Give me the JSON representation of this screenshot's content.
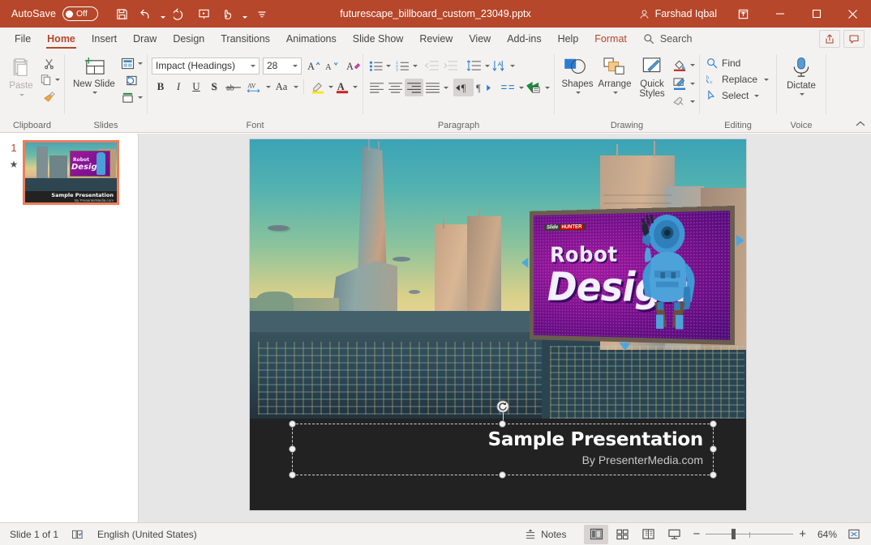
{
  "titlebar": {
    "autosave_label": "AutoSave",
    "autosave_state": "Off",
    "document_title": "futurescape_billboard_custom_23049.pptx",
    "account_name": "Farshad Iqbal",
    "qat": [
      {
        "name": "save-icon",
        "tooltip": "Save"
      },
      {
        "name": "undo-icon",
        "tooltip": "Undo"
      },
      {
        "name": "redo-icon",
        "tooltip": "Redo"
      },
      {
        "name": "start-slideshow-icon",
        "tooltip": "Start From Beginning"
      },
      {
        "name": "touch-mouse-mode-icon",
        "tooltip": "Touch/Mouse Mode"
      },
      {
        "name": "customize-qat-icon",
        "tooltip": "Customize Quick Access Toolbar"
      }
    ],
    "window_controls": [
      "ribbon-display-options",
      "minimize",
      "restore",
      "close"
    ]
  },
  "tabs": [
    {
      "label": "File",
      "active": false
    },
    {
      "label": "Home",
      "active": true
    },
    {
      "label": "Insert",
      "active": false
    },
    {
      "label": "Draw",
      "active": false
    },
    {
      "label": "Design",
      "active": false
    },
    {
      "label": "Transitions",
      "active": false
    },
    {
      "label": "Animations",
      "active": false
    },
    {
      "label": "Slide Show",
      "active": false
    },
    {
      "label": "Review",
      "active": false
    },
    {
      "label": "View",
      "active": false
    },
    {
      "label": "Add-ins",
      "active": false
    },
    {
      "label": "Help",
      "active": false
    },
    {
      "label": "Format",
      "active": false,
      "contextual": true
    }
  ],
  "search": {
    "placeholder": "Search",
    "label": "Search"
  },
  "tabbar_buttons": [
    {
      "name": "share-button",
      "label": "Share"
    },
    {
      "name": "comments-button",
      "label": "Comments"
    }
  ],
  "ribbon": {
    "groups": [
      {
        "name": "clipboard",
        "label": "Clipboard",
        "items": [
          {
            "name": "paste-button",
            "label": "Paste",
            "disabled": true
          },
          {
            "name": "cut-button",
            "label": "Cut"
          },
          {
            "name": "copy-button",
            "label": "Copy"
          },
          {
            "name": "format-painter-button",
            "label": "Format Painter"
          }
        ]
      },
      {
        "name": "slides",
        "label": "Slides",
        "items": [
          {
            "name": "new-slide-button",
            "label": "New Slide"
          },
          {
            "name": "layout-button",
            "label": "Layout"
          },
          {
            "name": "reset-button",
            "label": "Reset"
          },
          {
            "name": "section-button",
            "label": "Section"
          }
        ]
      },
      {
        "name": "font",
        "label": "Font",
        "font_name": "Impact (Headings)",
        "font_size": "28",
        "items": [
          {
            "name": "increase-font-size-button",
            "label": "Increase Font Size"
          },
          {
            "name": "decrease-font-size-button",
            "label": "Decrease Font Size"
          },
          {
            "name": "clear-formatting-button",
            "label": "Clear All Formatting"
          },
          {
            "name": "bold-button",
            "label": "B"
          },
          {
            "name": "italic-button",
            "label": "I"
          },
          {
            "name": "underline-button",
            "label": "U"
          },
          {
            "name": "text-shadow-button",
            "label": "S"
          },
          {
            "name": "strikethrough-button",
            "label": "ab"
          },
          {
            "name": "character-spacing-button",
            "label": "AV"
          },
          {
            "name": "change-case-button",
            "label": "Aa"
          },
          {
            "name": "text-highlight-color-button",
            "label": "Text Highlight Color"
          },
          {
            "name": "font-color-button",
            "label": "A"
          }
        ]
      },
      {
        "name": "paragraph",
        "label": "Paragraph",
        "items": [
          {
            "name": "bullets-button",
            "label": "Bullets"
          },
          {
            "name": "numbering-button",
            "label": "Numbering"
          },
          {
            "name": "decrease-indent-button",
            "label": "Decrease List Level",
            "disabled": true
          },
          {
            "name": "increase-indent-button",
            "label": "Increase List Level",
            "disabled": true
          },
          {
            "name": "line-spacing-button",
            "label": "Line Spacing"
          },
          {
            "name": "align-left-button",
            "label": "Align Left"
          },
          {
            "name": "align-center-button",
            "label": "Center"
          },
          {
            "name": "align-right-button",
            "label": "Align Right",
            "active": true
          },
          {
            "name": "justify-button",
            "label": "Justify"
          },
          {
            "name": "ltr-text-direction-button",
            "label": "Left-to-Right",
            "active": true
          },
          {
            "name": "rtl-text-direction-button",
            "label": "Right-to-Left"
          },
          {
            "name": "columns-button",
            "label": "Columns"
          },
          {
            "name": "text-direction-button",
            "label": "Text Direction"
          },
          {
            "name": "align-text-button",
            "label": "Align Text"
          },
          {
            "name": "convert-to-smartart-button",
            "label": "Convert to SmartArt"
          }
        ]
      },
      {
        "name": "drawing",
        "label": "Drawing",
        "items": [
          {
            "name": "shapes-button",
            "label": "Shapes"
          },
          {
            "name": "arrange-button",
            "label": "Arrange"
          },
          {
            "name": "quick-styles-button",
            "label": "Quick Styles"
          },
          {
            "name": "shape-fill-button",
            "label": "Shape Fill"
          },
          {
            "name": "shape-outline-button",
            "label": "Shape Outline"
          },
          {
            "name": "shape-effects-button",
            "label": "Shape Effects"
          }
        ]
      },
      {
        "name": "editing",
        "label": "Editing",
        "items": [
          {
            "name": "find-button",
            "label": "Find"
          },
          {
            "name": "replace-button",
            "label": "Replace"
          },
          {
            "name": "select-button",
            "label": "Select"
          }
        ]
      },
      {
        "name": "voice",
        "label": "Voice",
        "items": [
          {
            "name": "dictate-button",
            "label": "Dictate"
          }
        ]
      }
    ],
    "collapse_label": "Collapse the Ribbon"
  },
  "thumbnail_pane": {
    "slides": [
      {
        "number": "1",
        "animation_marker": "★"
      }
    ]
  },
  "slide": {
    "billboard": {
      "logo_a": "Slide",
      "logo_b": "HUNTER",
      "line1": "Robot",
      "line2": "Design"
    },
    "textbox": {
      "title": "Sample Presentation",
      "subtitle": "By PresenterMedia.com",
      "selected": true,
      "handles": 8,
      "rotation_handle": true
    }
  },
  "statusbar": {
    "slide_counter": "Slide 1 of 1",
    "accessibility_icon": "accessibility-checker-icon",
    "language": "English (United States)",
    "notes_label": "Notes",
    "views": [
      {
        "name": "normal-view-button",
        "label": "Normal",
        "selected": true
      },
      {
        "name": "slide-sorter-view-button",
        "label": "Slide Sorter",
        "selected": false
      },
      {
        "name": "reading-view-button",
        "label": "Reading View",
        "selected": false
      },
      {
        "name": "slide-show-button",
        "label": "Slide Show",
        "selected": false
      }
    ],
    "zoom_out_label": "−",
    "zoom_in_label": "+",
    "zoom_level": "64%",
    "fit_slide_label": "Fit slide to current window"
  },
  "colors": {
    "brand": "#b7472a",
    "ribbon_bg": "#f3f2f1",
    "canvas_bg": "#e6e6e6",
    "slide_dark": "#222222",
    "selection_border": "#ed7d5a",
    "billboard_magenta": "#a0189f"
  }
}
